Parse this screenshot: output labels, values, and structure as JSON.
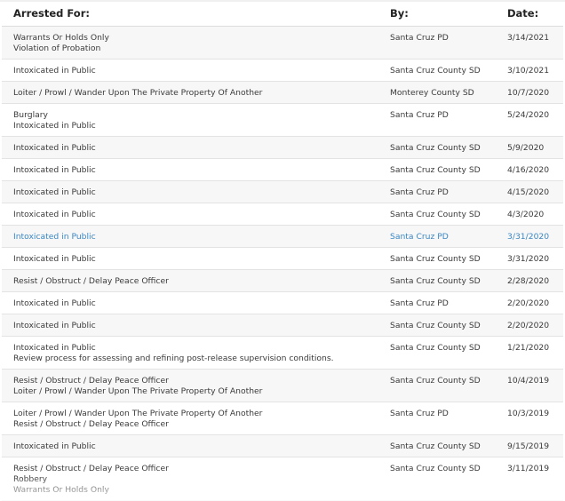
{
  "headers": {
    "arrested_for": "Arrested For:",
    "by": "By:",
    "date": "Date:"
  },
  "rows": [
    {
      "charges": [
        "Warrants Or Holds Only",
        "Violation of Probation"
      ],
      "by": "Santa Cruz PD",
      "date": "3/14/2021"
    },
    {
      "charges": [
        "Intoxicated in Public"
      ],
      "by": "Santa Cruz County SD",
      "date": "3/10/2021"
    },
    {
      "charges": [
        "Loiter / Prowl / Wander Upon The Private Property Of Another"
      ],
      "by": "Monterey County SD",
      "date": "10/7/2020"
    },
    {
      "charges": [
        "Burglary",
        "Intoxicated in Public"
      ],
      "by": "Santa Cruz PD",
      "date": "5/24/2020"
    },
    {
      "charges": [
        "Intoxicated in Public"
      ],
      "by": "Santa Cruz County SD",
      "date": "5/9/2020"
    },
    {
      "charges": [
        "Intoxicated in Public"
      ],
      "by": "Santa Cruz County SD",
      "date": "4/16/2020"
    },
    {
      "charges": [
        "Intoxicated in Public"
      ],
      "by": "Santa Cruz PD",
      "date": "4/15/2020"
    },
    {
      "charges": [
        "Intoxicated in Public"
      ],
      "by": "Santa Cruz County SD",
      "date": "4/3/2020"
    },
    {
      "charges": [
        "Intoxicated in Public"
      ],
      "by": "Santa Cruz PD",
      "date": "3/31/2020",
      "highlight": true
    },
    {
      "charges": [
        "Intoxicated in Public"
      ],
      "by": "Santa Cruz County SD",
      "date": "3/31/2020"
    },
    {
      "charges": [
        "Resist / Obstruct / Delay Peace Officer"
      ],
      "by": "Santa Cruz County SD",
      "date": "2/28/2020"
    },
    {
      "charges": [
        "Intoxicated in Public"
      ],
      "by": "Santa Cruz PD",
      "date": "2/20/2020"
    },
    {
      "charges": [
        "Intoxicated in Public"
      ],
      "by": "Santa Cruz County SD",
      "date": "2/20/2020"
    },
    {
      "charges": [
        "Intoxicated in Public",
        "Review process for assessing and refining post-release supervision conditions."
      ],
      "by": "Santa Cruz County SD",
      "date": "1/21/2020"
    },
    {
      "charges": [
        "Resist / Obstruct / Delay Peace Officer",
        "Loiter / Prowl / Wander Upon The Private Property Of Another"
      ],
      "by": "Santa Cruz County SD",
      "date": "10/4/2019"
    },
    {
      "charges": [
        "Loiter / Prowl / Wander Upon The Private Property Of Another",
        "Resist / Obstruct / Delay Peace Officer"
      ],
      "by": "Santa Cruz PD",
      "date": "10/3/2019"
    },
    {
      "charges": [
        "Intoxicated in Public"
      ],
      "by": "Santa Cruz County SD",
      "date": "9/15/2019"
    },
    {
      "charges": [
        "Resist / Obstruct / Delay Peace Officer",
        "Robbery",
        "Warrants Or Holds Only"
      ],
      "by": "Santa Cruz County SD",
      "date": "3/11/2019"
    }
  ],
  "colors": {
    "text": "#3a3a3a",
    "header_text": "#222222",
    "highlight": "#3b87c4",
    "row_alt": "#f7f7f7",
    "divider": "#e3e3e3"
  }
}
